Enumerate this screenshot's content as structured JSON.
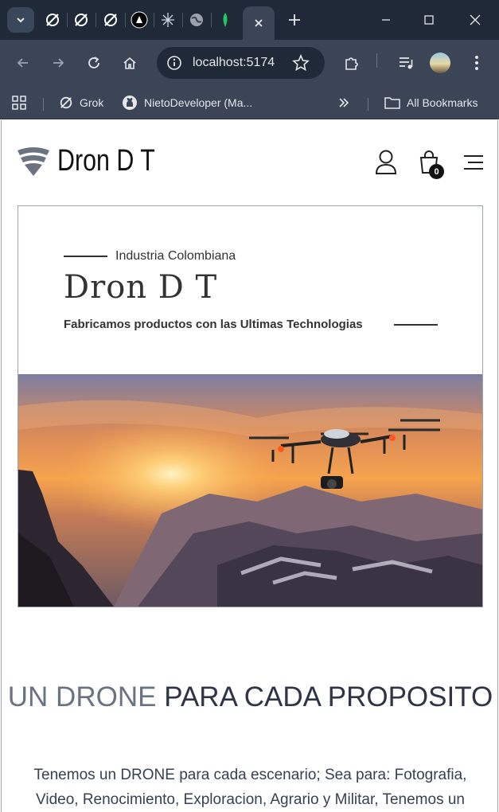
{
  "browser": {
    "address": "localhost:5174",
    "bookmarks": [
      "Grok",
      "NietoDeveloper (Ma...",
      "All Bookmarks"
    ],
    "tab_icons": [
      "grok-icon",
      "grok-icon",
      "grok-icon",
      "nextjs-icon",
      "perplexity-icon",
      "globe-icon",
      "mongodb-icon"
    ]
  },
  "site": {
    "brand": "Dron D T",
    "cart_count": "0"
  },
  "hero": {
    "kicker": "Industria Colombiana",
    "title": "Dron D T",
    "subtitle": "Fabricamos productos con las Ultimas Technologias"
  },
  "section": {
    "title_light": "UN DRONE",
    "title_bold": "PARA CADA PROPOSITO",
    "text": "Tenemos un DRONE para cada escenario; Sea para: Fotografia, Video, Renocimiento, Exploracion, Agrario y Militar, Tenemos un"
  },
  "colors": {
    "chrome_dark": "#1f2937",
    "chrome_toolbar": "#3b4556",
    "text_dark": "#333333"
  }
}
